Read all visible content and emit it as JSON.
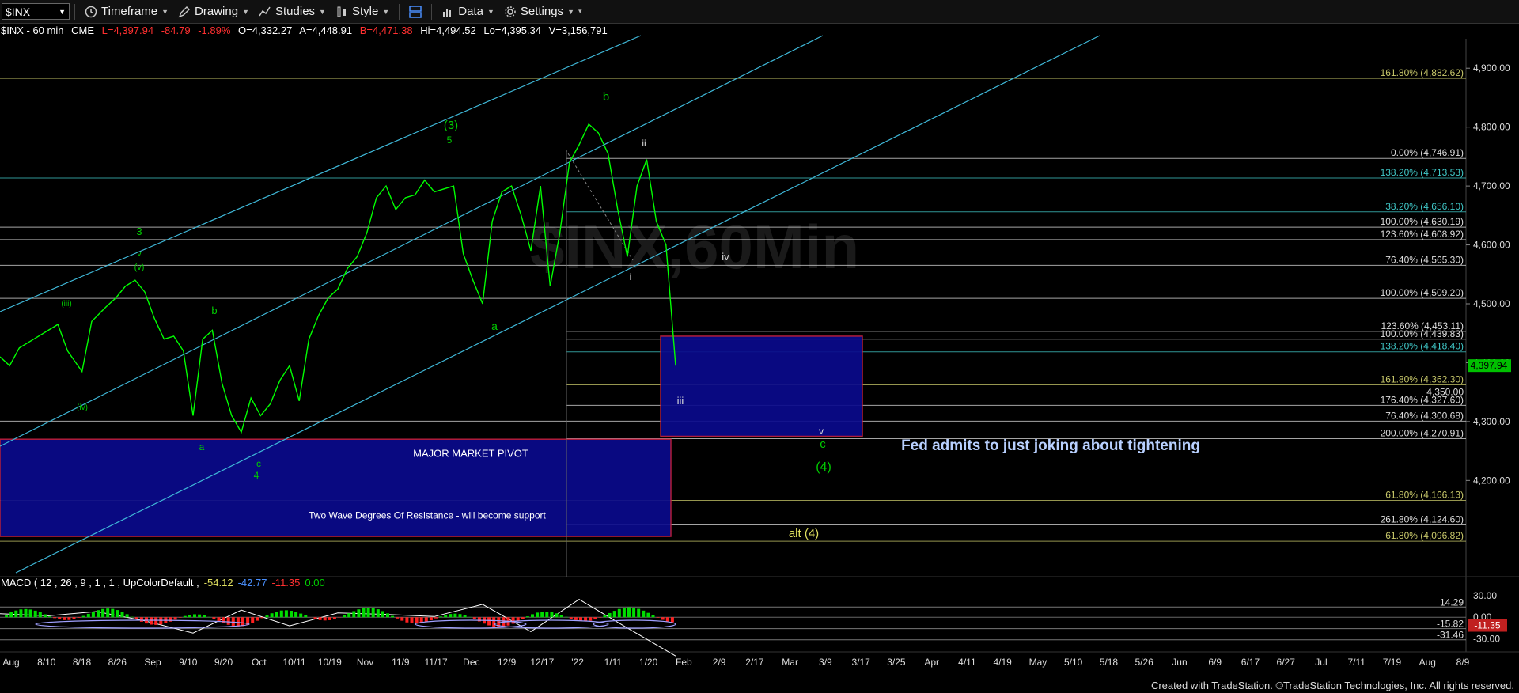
{
  "toolbar": {
    "symbol": "$INX",
    "timeframe": "Timeframe",
    "drawing": "Drawing",
    "studies": "Studies",
    "style": "Style",
    "data": "Data",
    "settings": "Settings"
  },
  "header": {
    "symbol_line": "$INX - 60 min",
    "exchange": "CME",
    "last": "L=4,397.94",
    "change": "-84.79",
    "change_pct": "-1.89%",
    "open": "O=4,332.27",
    "ask": "A=4,448.91",
    "bid": "B=4,471.38",
    "high": "Hi=4,494.52",
    "low": "Lo=4,395.34",
    "volume": "V=3,156,791"
  },
  "watermark": "$INX,60Min",
  "footer": "Created with TradeStation. ©TradeStation Technologies, Inc. All rights reserved.",
  "colors": {
    "price_line": "#00ff00",
    "channel": "#3fb8d8",
    "box_fill": "#0a0a8c",
    "box_border": "#c02040",
    "fib_yellow": "#c8c86a",
    "fib_cyan": "#40c8c8"
  },
  "chart_data": [
    {
      "type": "line",
      "title": "$INX - 60 min",
      "ylim": [
        4050,
        4950
      ],
      "y_ticks": [
        "4,900.00",
        "4,800.00",
        "4,700.00",
        "4,600.00",
        "4,500.00",
        "4,400.00",
        "4,300.00",
        "4,200.00"
      ],
      "y_tick_values": [
        4900,
        4800,
        4700,
        4600,
        4500,
        4400,
        4300,
        4200
      ],
      "x_ticks": [
        "Aug",
        "8/10",
        "8/18",
        "8/26",
        "Sep",
        "9/10",
        "9/20",
        "Oct",
        "10/11",
        "10/19",
        "Nov",
        "11/9",
        "11/17",
        "Dec",
        "12/9",
        "12/17",
        "'22",
        "1/11",
        "1/20",
        "Feb",
        "2/9",
        "2/17",
        "Mar",
        "3/9",
        "3/17",
        "3/25",
        "Apr",
        "4/11",
        "4/19",
        "May",
        "5/10",
        "5/18",
        "5/26",
        "Jun",
        "6/9",
        "6/17",
        "6/27",
        "Jul",
        "7/11",
        "7/19",
        "Aug",
        "8/9"
      ],
      "last_price_label": "4,397.94",
      "series": [
        {
          "x": [
            0,
            10,
            20,
            35,
            50,
            60,
            70,
            85,
            95,
            110,
            120,
            130,
            140,
            150,
            160,
            170,
            180,
            190,
            200,
            210,
            220,
            230,
            240,
            250,
            260,
            270,
            280,
            290,
            300,
            310,
            320,
            330,
            340,
            350,
            360,
            370,
            380,
            390,
            400,
            410,
            420,
            430,
            440,
            450,
            460,
            470,
            480,
            490,
            500,
            510,
            520,
            530,
            540,
            550,
            560,
            570,
            580,
            590,
            600,
            610,
            620,
            630,
            640,
            650,
            660,
            670,
            680,
            690,
            700
          ],
          "y": [
            4410,
            4395,
            4425,
            4440,
            4455,
            4465,
            4420,
            4385,
            4470,
            4495,
            4510,
            4530,
            4540,
            4520,
            4475,
            4440,
            4445,
            4420,
            4310,
            4440,
            4455,
            4365,
            4310,
            4282,
            4340,
            4310,
            4330,
            4370,
            4395,
            4335,
            4440,
            4480,
            4510,
            4525,
            4560,
            4580,
            4620,
            4680,
            4700,
            4660,
            4680,
            4685,
            4710,
            4690,
            4695,
            4700,
            4585,
            4540,
            4500,
            4640,
            4690,
            4700,
            4650,
            4590,
            4700,
            4530,
            4620,
            4740,
            4770,
            4805,
            4790,
            4755,
            4660,
            4580,
            4700,
            4745,
            4640,
            4600,
            4395
          ]
        }
      ],
      "fib_levels": [
        {
          "label": "161.80% (4,882.62)",
          "value": 4882.62,
          "color": "#c8c86a"
        },
        {
          "label": "0.00% (4,746.91)",
          "value": 4746.91,
          "color": "#dddddd"
        },
        {
          "label": "138.20% (4,713.53)",
          "value": 4713.53,
          "color": "#40c8c8"
        },
        {
          "label": "38.20% (4,656.10)",
          "value": 4656.1,
          "color": "#40c8c8"
        },
        {
          "label": "100.00% (4,630.19)",
          "value": 4630.19,
          "color": "#dddddd"
        },
        {
          "label": "123.60% (4,608.92)",
          "value": 4608.92,
          "color": "#dddddd"
        },
        {
          "label": "76.40% (4,565.30)",
          "value": 4565.3,
          "color": "#dddddd"
        },
        {
          "label": "100.00% (4,509.20)",
          "value": 4509.2,
          "color": "#dddddd"
        },
        {
          "label": "123.60% (4,453.11)",
          "value": 4453.11,
          "color": "#dddddd"
        },
        {
          "label": "100.00% (4,439.83)",
          "value": 4439.83,
          "color": "#dddddd"
        },
        {
          "label": "138.20% (4,418.40)",
          "value": 4418.4,
          "color": "#40c8c8"
        },
        {
          "label": "161.80% (4,362.30)",
          "value": 4362.3,
          "color": "#c8c86a"
        },
        {
          "label": "176.40% (4,327.60)",
          "value": 4327.6,
          "color": "#dddddd"
        },
        {
          "label": "76.40% (4,300.68)",
          "value": 4300.68,
          "color": "#dddddd"
        },
        {
          "label": "200.00% (4,270.91)",
          "value": 4270.91,
          "color": "#dddddd"
        },
        {
          "label": "61.80% (4,166.13)",
          "value": 4166.13,
          "color": "#c8c86a"
        },
        {
          "label": "261.80% (4,124.60)",
          "value": 4124.6,
          "color": "#dddddd"
        },
        {
          "label": "61.80% (4,096.82)",
          "value": 4096.82,
          "color": "#c8c86a"
        }
      ],
      "extra_price_label": "4,350.00",
      "target_box": {
        "y_top": 4445,
        "y_bottom": 4275
      },
      "pivot_box": {
        "y_top": 4270,
        "y_bottom": 4105,
        "label": "MAJOR MARKET PIVOT",
        "label2": "Two Wave Degrees Of Resistance - will become support"
      },
      "annotations": [
        {
          "text": "(3)",
          "color": "#00cc00"
        },
        {
          "text": "5",
          "color": "#00cc00"
        },
        {
          "text": "b",
          "color": "#00cc00"
        },
        {
          "text": "a",
          "color": "#00cc00"
        },
        {
          "text": "3",
          "color": "#00cc00"
        },
        {
          "text": "v",
          "color": "#00cc00"
        },
        {
          "text": "(v)",
          "color": "#00cc00"
        },
        {
          "text": "(iii)",
          "color": "#00cc00"
        },
        {
          "text": "(iv)",
          "color": "#00cc00"
        },
        {
          "text": "b",
          "color": "#00cc00"
        },
        {
          "text": "a",
          "color": "#00cc00"
        },
        {
          "text": "c",
          "color": "#00cc00"
        },
        {
          "text": "4",
          "color": "#00cc00"
        },
        {
          "text": "ii",
          "color": "#dddddd"
        },
        {
          "text": "i",
          "color": "#dddddd"
        },
        {
          "text": "iv",
          "color": "#dddddd"
        },
        {
          "text": "iii",
          "color": "#dddddd"
        },
        {
          "text": "v",
          "color": "#dddddd"
        },
        {
          "text": "c",
          "color": "#00cc00"
        },
        {
          "text": "(4)",
          "color": "#00cc00"
        },
        {
          "text": "alt (4)",
          "color": "#e0e060"
        },
        {
          "text": "Fed admits to just joking about tightening",
          "color": "#b8d0ff"
        }
      ]
    },
    {
      "type": "line",
      "title": "MACD ( 12 , 26 , 9 , 1 , 1 , UpColorDefault , -54.12 -42.77 -11.35 0.00",
      "indicator_label": "MACD ( 12 , 26 , 9 , 1 , 1 , UpColorDefault ,",
      "values": [
        "-54.12",
        "-42.77",
        "-11.35",
        "0.00"
      ],
      "ylim": [
        -45,
        40
      ],
      "y_ticks": [
        "30.00",
        "0.00",
        "-30.00"
      ],
      "y_tick_values": [
        30,
        0,
        -30
      ],
      "level_labels": [
        "14.29",
        "-15.82",
        "-31.46"
      ],
      "level_values": [
        14.29,
        -15.82,
        -31.46
      ],
      "last_label": "-11.35",
      "series": [
        {
          "name": "MACD",
          "x": [
            0,
            50,
            100,
            150,
            200,
            250,
            300,
            350,
            400,
            450,
            500,
            550,
            600,
            650,
            700
          ],
          "y": [
            5,
            2,
            8,
            -5,
            -22,
            10,
            -12,
            6,
            4,
            1,
            18,
            -20,
            25,
            -15,
            -54
          ]
        }
      ]
    }
  ]
}
